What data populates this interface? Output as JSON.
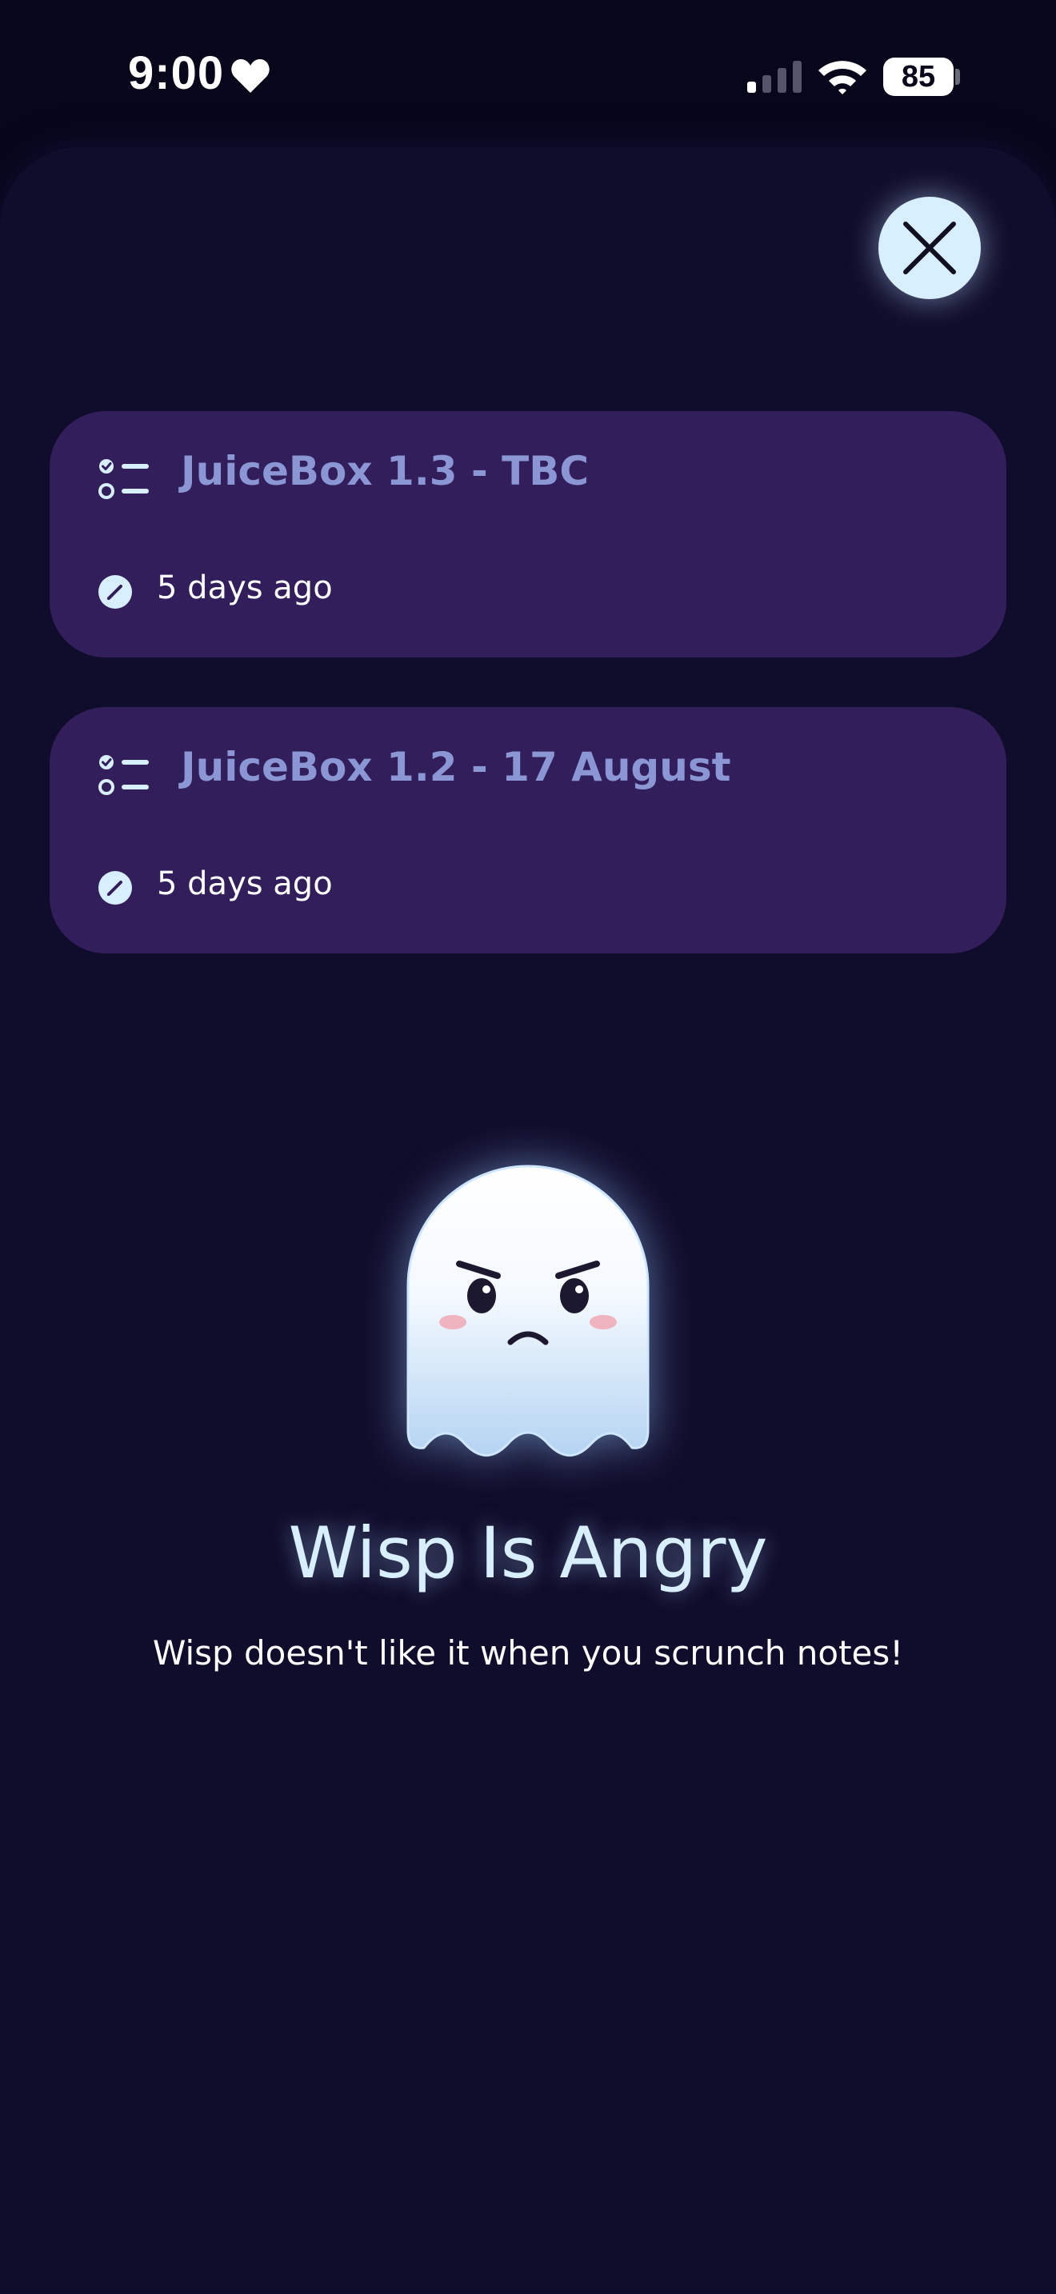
{
  "status_bar": {
    "time": "9:00",
    "battery": "85",
    "icons": [
      "heart-icon",
      "signal-icon",
      "wifi-icon",
      "battery-icon"
    ]
  },
  "close_icon": "close-icon",
  "notes": [
    {
      "title": "JuiceBox 1.3 - TBC",
      "edited": "5 days ago",
      "type_icon": "checklist-icon",
      "edit_icon": "edit-icon"
    },
    {
      "title": "JuiceBox 1.2 - 17 August",
      "edited": "5 days ago",
      "type_icon": "checklist-icon",
      "edit_icon": "edit-icon"
    }
  ],
  "empty_state": {
    "illustration": "angry-ghost",
    "title": "Wisp Is Angry",
    "subtitle": "Wisp doesn't like it when you scrunch notes!"
  },
  "colors": {
    "background": "#07061a",
    "sheet": "#100c2b",
    "card": "#321e5b",
    "card_title": "#8b96d4",
    "accent_light": "#d8efff"
  }
}
